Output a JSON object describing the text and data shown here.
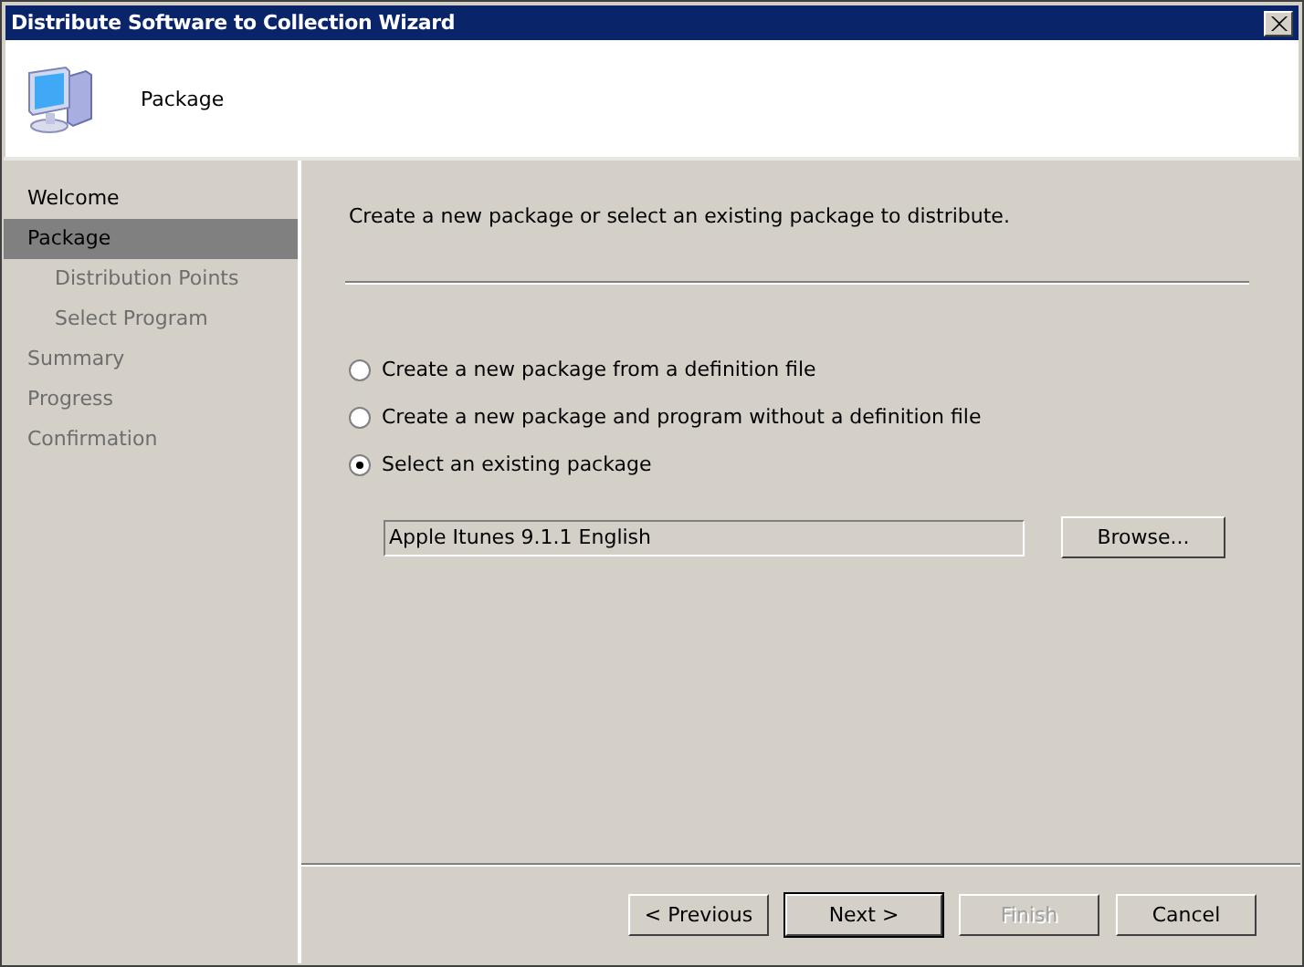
{
  "window": {
    "title": "Distribute Software to Collection Wizard"
  },
  "header": {
    "title": "Package"
  },
  "sidebar": {
    "items": [
      {
        "label": "Welcome",
        "selected": false,
        "disabled": false
      },
      {
        "label": "Package",
        "selected": true,
        "disabled": false,
        "children": [
          {
            "label": "Distribution Points",
            "selected": false,
            "disabled": true
          },
          {
            "label": "Select Program",
            "selected": false,
            "disabled": true
          }
        ]
      },
      {
        "label": "Summary",
        "selected": false,
        "disabled": true
      },
      {
        "label": "Progress",
        "selected": false,
        "disabled": true
      },
      {
        "label": "Confirmation",
        "selected": false,
        "disabled": true
      }
    ]
  },
  "content": {
    "instruction": "Create a new package or select an existing package to distribute.",
    "options": [
      {
        "label": "Create a new package from a definition file",
        "selected": false
      },
      {
        "label": "Create a new package and program without a definition file",
        "selected": false
      },
      {
        "label": "Select an existing package",
        "selected": true
      }
    ],
    "package_field": {
      "value": "Apple Itunes 9.1.1 English"
    },
    "browse_button": "Browse..."
  },
  "buttons": [
    {
      "label": "< Previous",
      "disabled": false,
      "default": false
    },
    {
      "label": "Next >",
      "disabled": false,
      "default": true
    },
    {
      "label": "Finish",
      "disabled": true,
      "default": false
    },
    {
      "label": "Cancel",
      "disabled": false,
      "default": false
    }
  ]
}
